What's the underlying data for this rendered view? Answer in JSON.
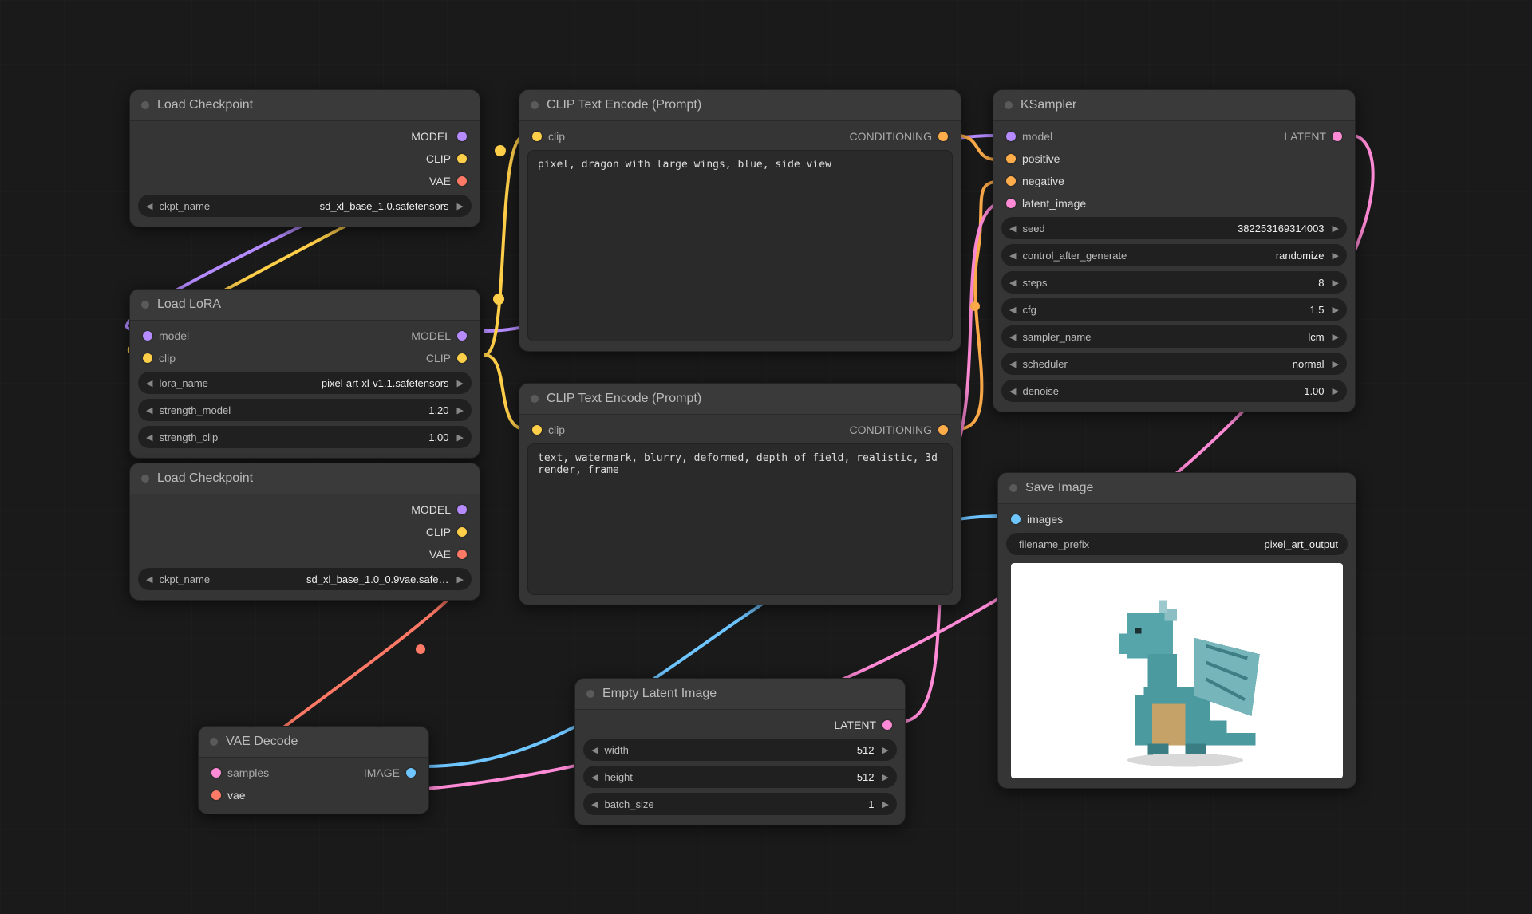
{
  "nodes": {
    "load_checkpoint_1": {
      "title": "Load Checkpoint",
      "outputs": {
        "model": "MODEL",
        "clip": "CLIP",
        "vae": "VAE"
      },
      "widgets": {
        "ckpt_name": {
          "label": "ckpt_name",
          "value": "sd_xl_base_1.0.safetensors"
        }
      }
    },
    "load_lora": {
      "title": "Load LoRA",
      "inputs": {
        "model": "model",
        "clip": "clip"
      },
      "outputs": {
        "model": "MODEL",
        "clip": "CLIP"
      },
      "widgets": {
        "lora_name": {
          "label": "lora_name",
          "value": "pixel-art-xl-v1.1.safetensors"
        },
        "strength_model": {
          "label": "strength_model",
          "value": "1.20"
        },
        "strength_clip": {
          "label": "strength_clip",
          "value": "1.00"
        }
      }
    },
    "load_checkpoint_2": {
      "title": "Load Checkpoint",
      "outputs": {
        "model": "MODEL",
        "clip": "CLIP",
        "vae": "VAE"
      },
      "widgets": {
        "ckpt_name": {
          "label": "ckpt_name",
          "value": "sd_xl_base_1.0_0.9vae.safe…"
        }
      }
    },
    "clip_pos": {
      "title": "CLIP Text Encode (Prompt)",
      "inputs": {
        "clip": "clip"
      },
      "outputs": {
        "conditioning": "CONDITIONING"
      },
      "text": "pixel, dragon with large wings, blue, side view"
    },
    "clip_neg": {
      "title": "CLIP Text Encode (Prompt)",
      "inputs": {
        "clip": "clip"
      },
      "outputs": {
        "conditioning": "CONDITIONING"
      },
      "text": "text, watermark, blurry, deformed, depth of field, realistic, 3d render, frame"
    },
    "empty_latent": {
      "title": "Empty Latent Image",
      "outputs": {
        "latent": "LATENT"
      },
      "widgets": {
        "width": {
          "label": "width",
          "value": "512"
        },
        "height": {
          "label": "height",
          "value": "512"
        },
        "batch_size": {
          "label": "batch_size",
          "value": "1"
        }
      }
    },
    "vae_decode": {
      "title": "VAE Decode",
      "inputs": {
        "samples": "samples",
        "vae": "vae"
      },
      "outputs": {
        "image": "IMAGE"
      }
    },
    "ksampler": {
      "title": "KSampler",
      "inputs": {
        "model": "model",
        "positive": "positive",
        "negative": "negative",
        "latent_image": "latent_image"
      },
      "outputs": {
        "latent": "LATENT"
      },
      "widgets": {
        "seed": {
          "label": "seed",
          "value": "382253169314003"
        },
        "control_after_generate": {
          "label": "control_after_generate",
          "value": "randomize"
        },
        "steps": {
          "label": "steps",
          "value": "8"
        },
        "cfg": {
          "label": "cfg",
          "value": "1.5"
        },
        "sampler_name": {
          "label": "sampler_name",
          "value": "lcm"
        },
        "scheduler": {
          "label": "scheduler",
          "value": "normal"
        },
        "denoise": {
          "label": "denoise",
          "value": "1.00"
        }
      }
    },
    "save_image": {
      "title": "Save Image",
      "inputs": {
        "images": "images"
      },
      "widgets": {
        "filename_prefix": {
          "label": "filename_prefix",
          "value": "pixel_art_output"
        }
      }
    }
  },
  "colors": {
    "purple": "#b58bff",
    "yellow": "#ffcf4a",
    "red": "#ff7a66",
    "orange": "#ffad4a",
    "pink": "#ff8ad6",
    "cyan": "#6ec5ff"
  }
}
